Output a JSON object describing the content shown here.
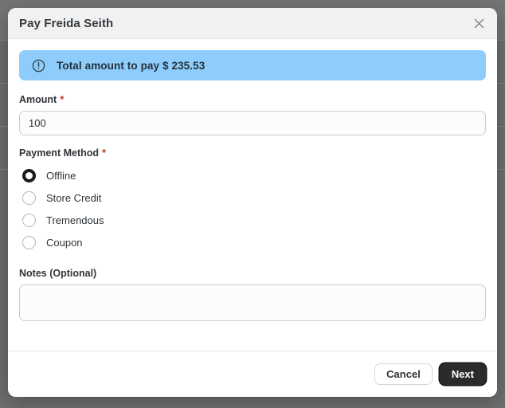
{
  "modal": {
    "title": "Pay Freida Seith",
    "close_icon": "close-icon",
    "banner": {
      "icon": "exclamation-circle-icon",
      "text": "Total amount to pay $ 235.53",
      "background_color": "#8ecdfb"
    },
    "fields": {
      "amount": {
        "label": "Amount",
        "required_marker": "*",
        "value": "100",
        "placeholder": ""
      },
      "payment_method": {
        "label": "Payment Method",
        "required_marker": "*",
        "selected": "Offline",
        "options": [
          {
            "label": "Offline",
            "selected": true
          },
          {
            "label": "Store Credit",
            "selected": false
          },
          {
            "label": "Tremendous",
            "selected": false
          },
          {
            "label": "Coupon",
            "selected": false
          }
        ]
      },
      "notes": {
        "label": "Notes (Optional)",
        "value": "",
        "placeholder": ""
      }
    },
    "footer": {
      "cancel_label": "Cancel",
      "next_label": "Next"
    }
  },
  "colors": {
    "accent_blue": "#8ecdfb",
    "required_red": "#c0392b",
    "primary_button": "#2b2b2b",
    "backdrop": "#6e6e6e",
    "header_bar": "#f1f1f1"
  }
}
